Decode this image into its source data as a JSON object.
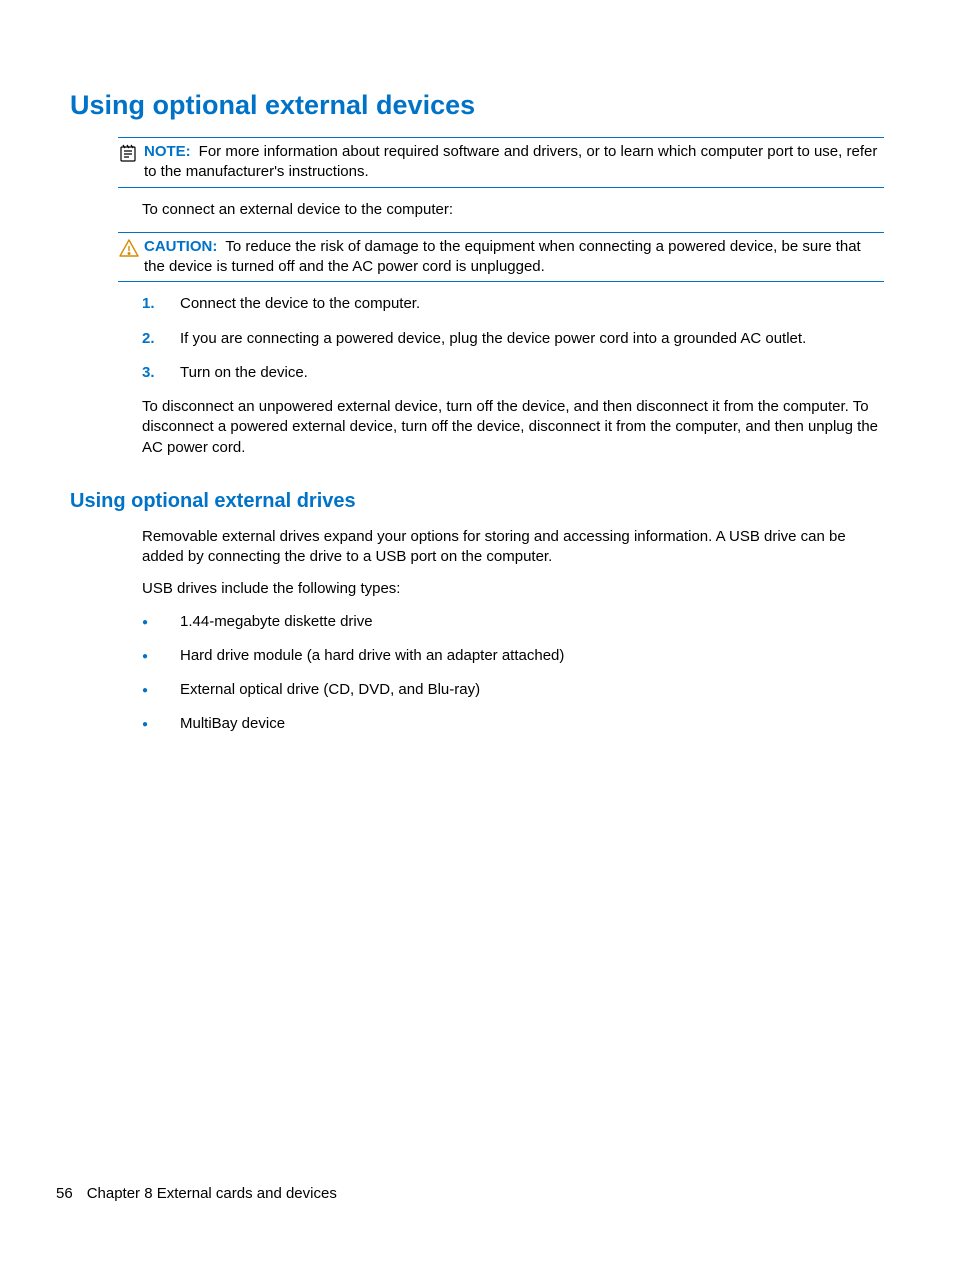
{
  "heading": "Using optional external devices",
  "note": {
    "label": "NOTE:",
    "text": "For more information about required software and drivers, or to learn which computer port to use, refer to the manufacturer's instructions."
  },
  "intro": "To connect an external device to the computer:",
  "caution": {
    "label": "CAUTION:",
    "text": "To reduce the risk of damage to the equipment when connecting a powered device, be sure that the device is turned off and the AC power cord is unplugged."
  },
  "steps": [
    "Connect the device to the computer.",
    "If you are connecting a powered device, plug the device power cord into a grounded AC outlet.",
    "Turn on the device."
  ],
  "para_disconnect": "To disconnect an unpowered external device, turn off the device, and then disconnect it from the computer. To disconnect a powered external device, turn off the device, disconnect it from the computer, and then unplug the AC power cord.",
  "subheading": "Using optional external drives",
  "drives_para1": "Removable external drives expand your options for storing and accessing information. A USB drive can be added by connecting the drive to a USB port on the computer.",
  "drives_para2": "USB drives include the following types:",
  "bullets": [
    "1.44-megabyte diskette drive",
    "Hard drive module (a hard drive with an adapter attached)",
    "External optical drive (CD, DVD, and Blu-ray)",
    "MultiBay device"
  ],
  "footer": {
    "page": "56",
    "chapter": "Chapter 8   External cards and devices"
  }
}
